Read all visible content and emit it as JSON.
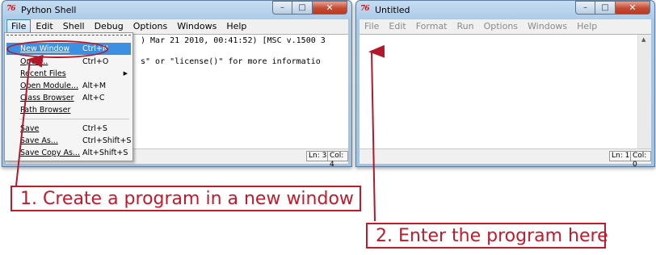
{
  "shell_window": {
    "icon": "76",
    "title": "Python Shell",
    "menu": [
      "File",
      "Edit",
      "Shell",
      "Debug",
      "Options",
      "Windows",
      "Help"
    ],
    "text_lines": [
      ") Mar 21 2010, 00:41:52) [MSC v.1500 3",
      "s\" or \"license()\" for more informatio"
    ],
    "status": {
      "line": "Ln: 3",
      "col": "Col: 4"
    }
  },
  "file_menu": {
    "items": [
      {
        "label": "New Window",
        "shortcut": "Ctrl+N"
      },
      {
        "label": "Open...",
        "shortcut": "Ctrl+O"
      },
      {
        "label": "Recent Files",
        "shortcut": ""
      },
      {
        "label": "Open Module...",
        "shortcut": "Alt+M"
      },
      {
        "label": "Class Browser",
        "shortcut": "Alt+C"
      },
      {
        "label": "Path Browser",
        "shortcut": ""
      },
      {
        "label": "Save",
        "shortcut": "Ctrl+S"
      },
      {
        "label": "Save As...",
        "shortcut": "Ctrl+Shift+S"
      },
      {
        "label": "Save Copy As...",
        "shortcut": "Alt+Shift+S"
      }
    ]
  },
  "untitled_window": {
    "icon": "76",
    "title": "Untitled",
    "menu": [
      "File",
      "Edit",
      "Format",
      "Run",
      "Options",
      "Windows",
      "Help"
    ],
    "status": {
      "line": "Ln: 1",
      "col": "Col: 0"
    }
  },
  "caption_buttons": {
    "minimize": "–",
    "maximize": "□",
    "close": "✕"
  },
  "callouts": {
    "step1": "1. Create a program in a new window",
    "step2": "2. Enter the program here"
  },
  "colors": {
    "annotation_red": "#c31a2b",
    "menu_highlight": "#3c8fe1"
  }
}
